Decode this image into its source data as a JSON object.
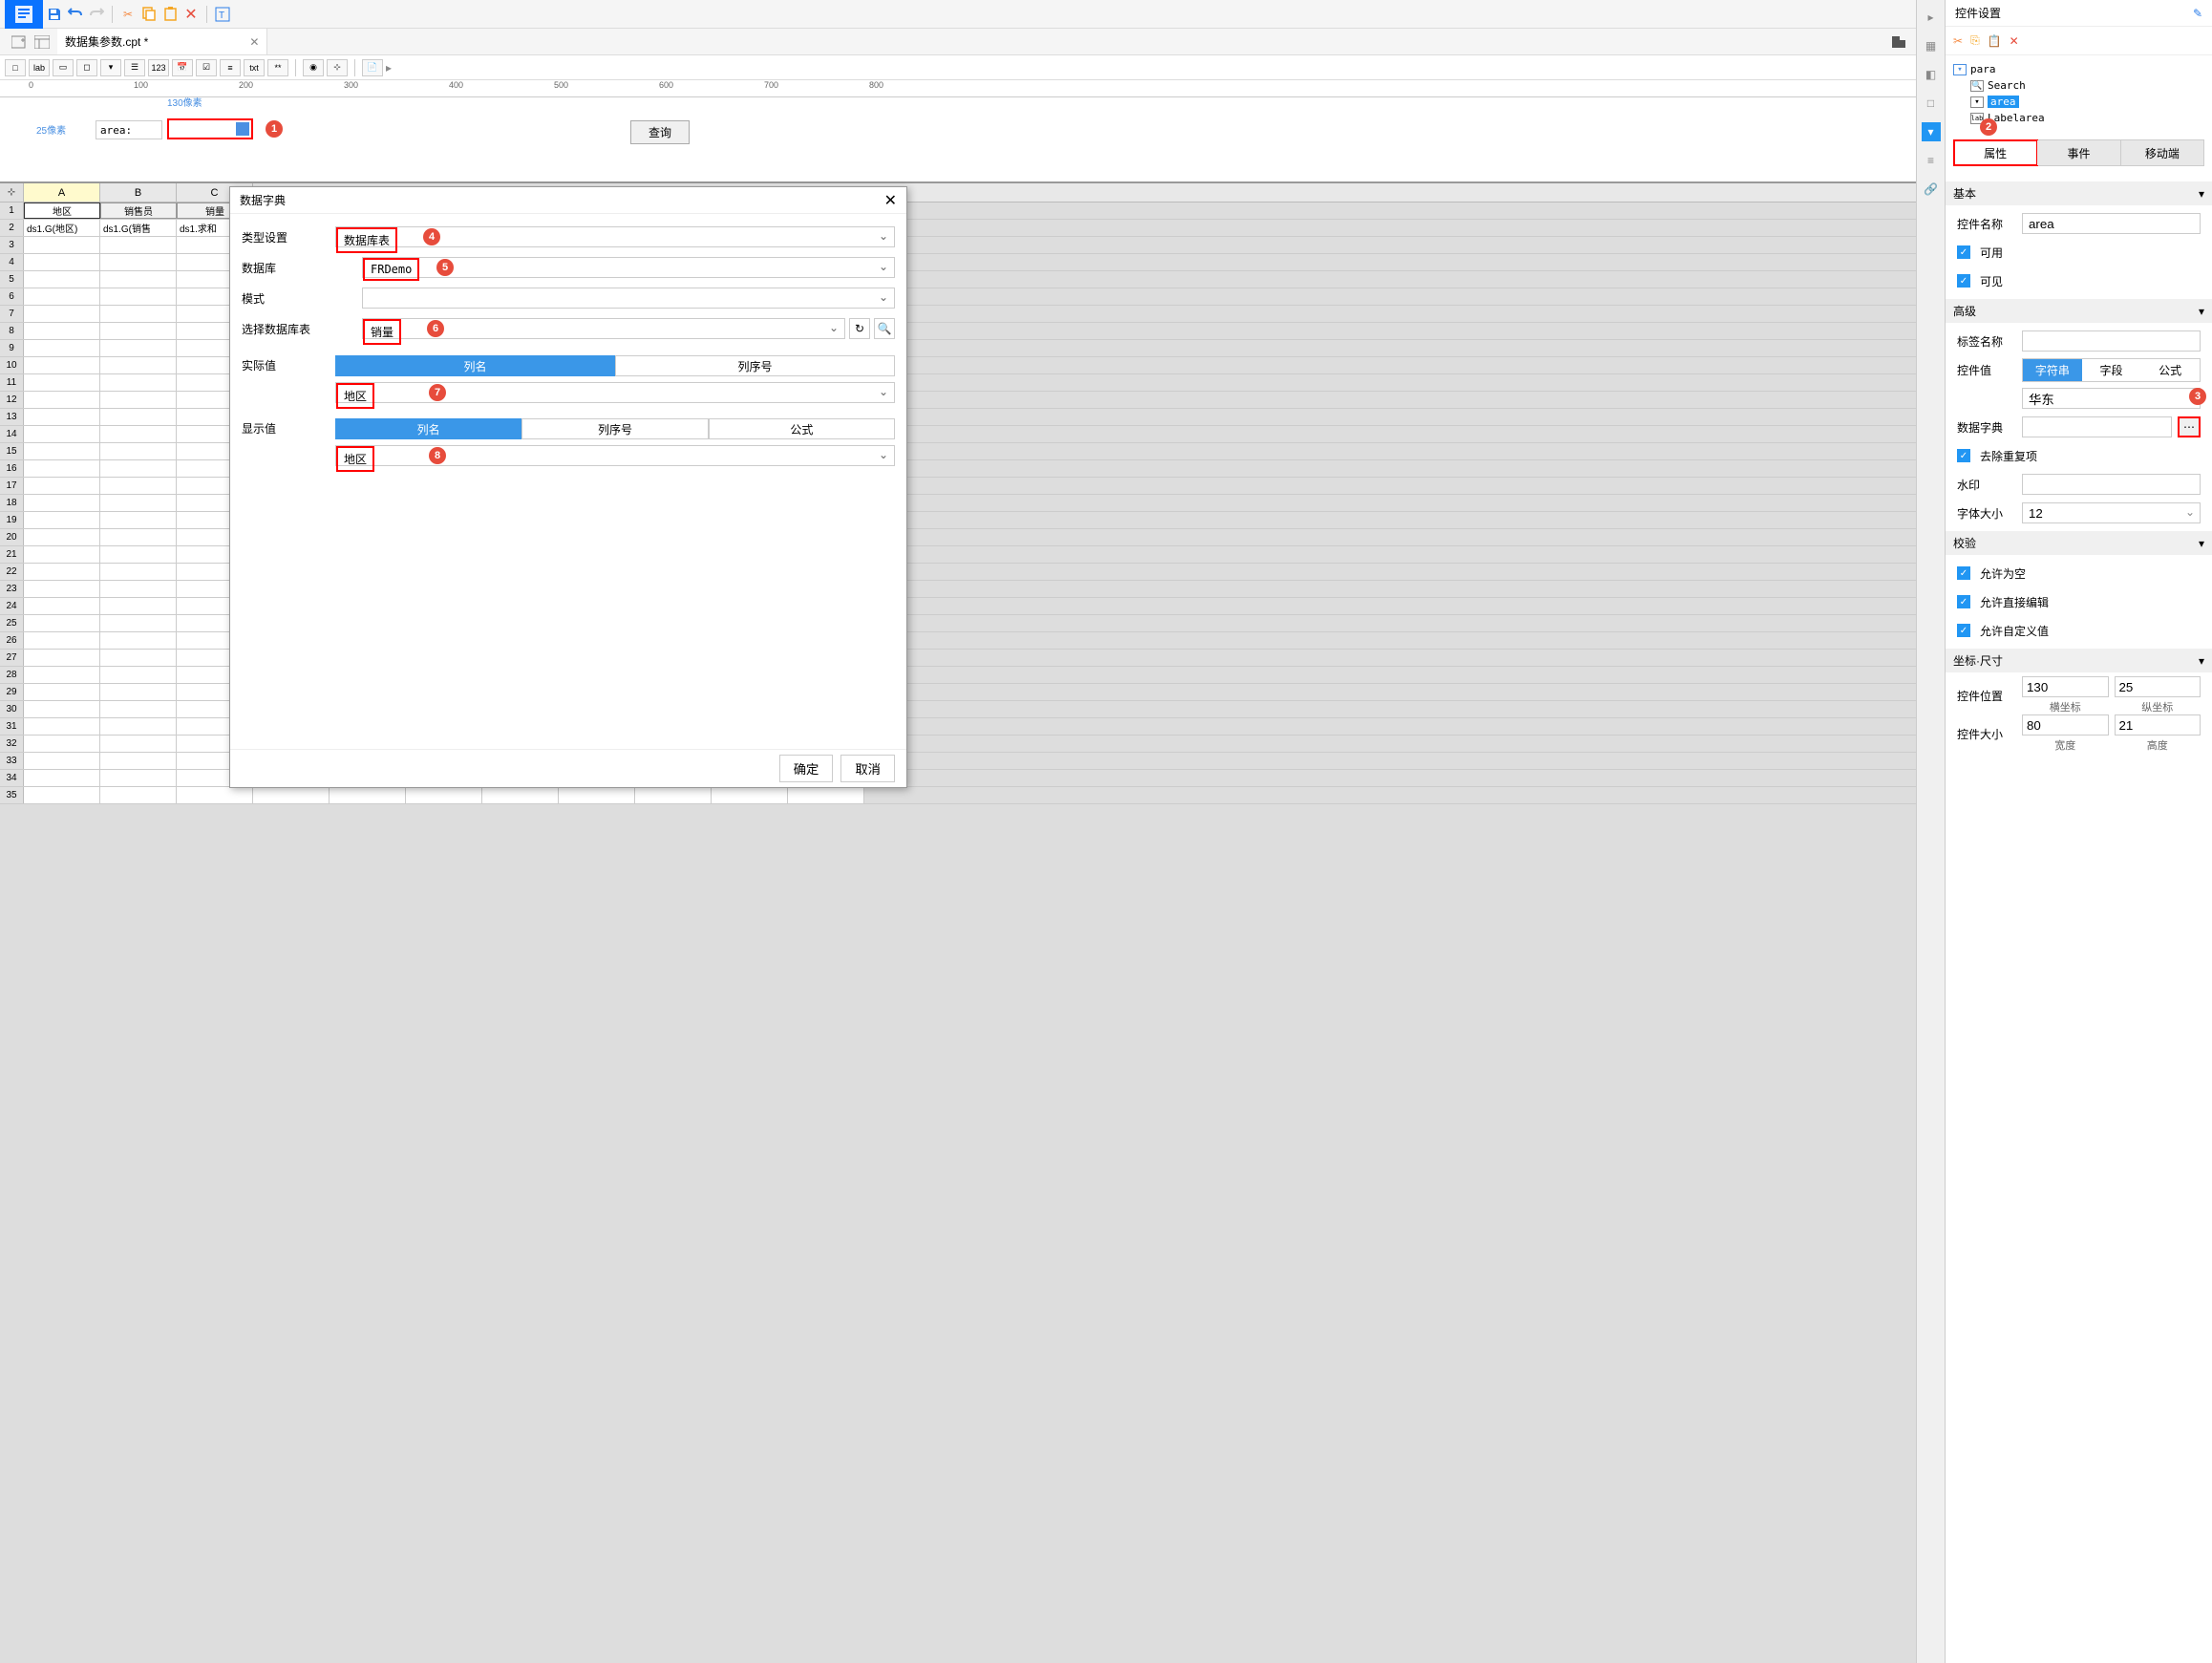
{
  "tab": {
    "title": "数据集参数.cpt *"
  },
  "design": {
    "width_label": "130像素",
    "height_label": "25像素",
    "area_label": "area:",
    "query_btn": "查询"
  },
  "ruler": [
    "0",
    "100",
    "200",
    "300",
    "400",
    "500",
    "600",
    "700",
    "800"
  ],
  "grid": {
    "cols": [
      "A",
      "B",
      "C"
    ],
    "row1": [
      "地区",
      "销售员",
      "销量"
    ],
    "row2": [
      "ds1.G(地区)",
      "ds1.G(销售",
      "ds1.求和"
    ]
  },
  "dialog": {
    "title": "数据字典",
    "type_label": "类型设置",
    "type_value": "数据库表",
    "db_label": "数据库",
    "db_value": "FRDemo",
    "schema_label": "模式",
    "schema_value": "",
    "table_label": "选择数据库表",
    "table_value": "销量",
    "actual_label": "实际值",
    "display_label": "显示值",
    "colname": "列名",
    "colindex": "列序号",
    "formula": "公式",
    "actual_value": "地区",
    "display_value": "地区",
    "ok": "确定",
    "cancel": "取消"
  },
  "right": {
    "title": "控件设置",
    "tree": {
      "root": "para",
      "items": [
        "Search",
        "area",
        "Labelarea"
      ]
    },
    "tabs": [
      "属性",
      "事件",
      "移动端"
    ],
    "basic_hdr": "基本",
    "name_label": "控件名称",
    "name_value": "area",
    "enable": "可用",
    "visible": "可见",
    "adv_hdr": "高级",
    "tag_label": "标签名称",
    "value_label": "控件值",
    "value_seg": [
      "字符串",
      "字段",
      "公式"
    ],
    "value_text": "华东",
    "dict_label": "数据字典",
    "dedup": "去除重复项",
    "watermark": "水印",
    "fontsize_label": "字体大小",
    "fontsize_value": "12",
    "valid_hdr": "校验",
    "allow_empty": "允许为空",
    "allow_edit": "允许直接编辑",
    "allow_custom": "允许自定义值",
    "coord_hdr": "坐标·尺寸",
    "pos_label": "控件位置",
    "pos_x": "130",
    "pos_y": "25",
    "pos_x_lbl": "横坐标",
    "pos_y_lbl": "纵坐标",
    "size_label": "控件大小",
    "size_w": "80",
    "size_h": "21",
    "size_w_lbl": "宽度",
    "size_h_lbl": "高度"
  },
  "badges": [
    "1",
    "2",
    "3",
    "4",
    "5",
    "6",
    "7",
    "8"
  ]
}
